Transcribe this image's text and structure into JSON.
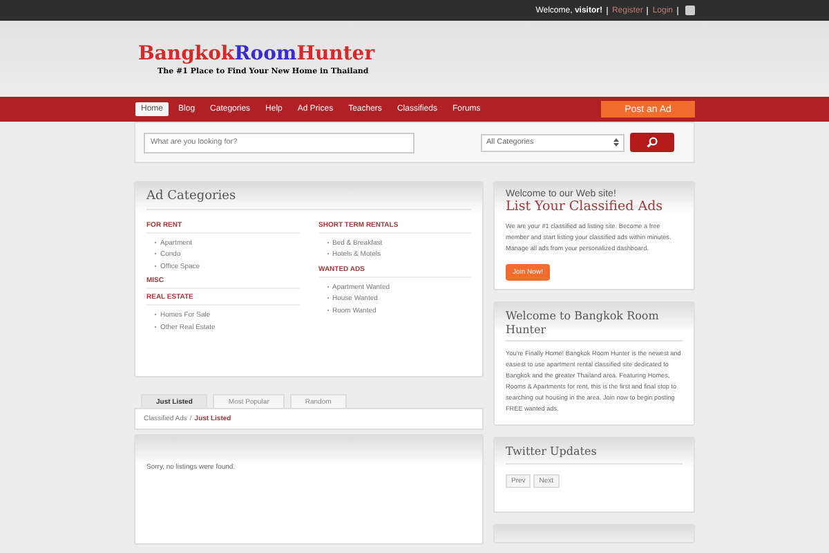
{
  "topbar": {
    "welcome": "Welcome,",
    "user": "visitor!",
    "links": [
      {
        "label": "Register"
      },
      {
        "label": "Login"
      }
    ]
  },
  "logo": {
    "parts": [
      {
        "text": "Bangkok",
        "color": "#d42a2a"
      },
      {
        "text": "Room",
        "color": "#3a2bd0"
      },
      {
        "text": "Hunter",
        "color": "#d42a2a"
      }
    ],
    "tagline": "The #1 Place to Find Your New Home in Thailand"
  },
  "nav": {
    "items": [
      {
        "label": "Home",
        "selected": true
      },
      {
        "label": "Blog",
        "selected": false
      },
      {
        "label": "Categories",
        "selected": false
      },
      {
        "label": "Help",
        "selected": false
      },
      {
        "label": "Ad Prices",
        "selected": false
      },
      {
        "label": "Teachers",
        "selected": false
      },
      {
        "label": "Classifieds",
        "selected": false
      },
      {
        "label": "Forums",
        "selected": false
      }
    ],
    "post_button": "Post an Ad"
  },
  "search": {
    "placeholder": "What are you looking for?",
    "category": "All Categories"
  },
  "ad_categories": {
    "title": "Ad Categories",
    "columns": [
      [
        {
          "heading": "FOR RENT",
          "items": [
            "Apartment",
            "Condo",
            "Office Space"
          ]
        },
        {
          "heading": "MISC"
        },
        {
          "heading": "REAL ESTATE",
          "items": [
            "Homes For Sale",
            "Other Real Estate"
          ]
        }
      ],
      [
        {
          "heading": "SHORT TERM RENTALS",
          "items": [
            "Bed & Breakfast",
            "Hotels & Motels"
          ]
        },
        {
          "heading": "WANTED ADS",
          "items": [
            "Apartment Wanted",
            "House Wanted",
            "Room Wanted"
          ]
        }
      ]
    ]
  },
  "listing_tabs": [
    {
      "label": "Just Listed",
      "selected": true
    },
    {
      "label": "Most Popular",
      "selected": false
    },
    {
      "label": "Random",
      "selected": false
    }
  ],
  "breadcrumb": {
    "parent": "Classified Ads",
    "separator": "/",
    "current": "Just Listed"
  },
  "listings": {
    "message": "Sorry, no listings were found."
  },
  "welcome_card": {
    "kicker": "Welcome to our Web site!",
    "title": "List Your Classified Ads",
    "body": "We are your #1 classified ad listing site. Become a free member and start listing your classified ads within minutes. Manage all ads from your personalized dashboard.",
    "button": "Join Now!"
  },
  "about_card": {
    "title": "Welcome to Bangkok Room Hunter",
    "body": "You're Finally Home! Bangkok Room Hunter is the newest and easiest to use apartment rental classified site dedicated to Bangkok and the greater Thailand area. Featuring Homes, Rooms & Apartments for rent, this is the first and final stop to searching out housing in the area. Join now to begin posting FREE wanted ads."
  },
  "twitter_card": {
    "title": "Twitter Updates",
    "buttons": [
      "Prev",
      "Next"
    ]
  }
}
